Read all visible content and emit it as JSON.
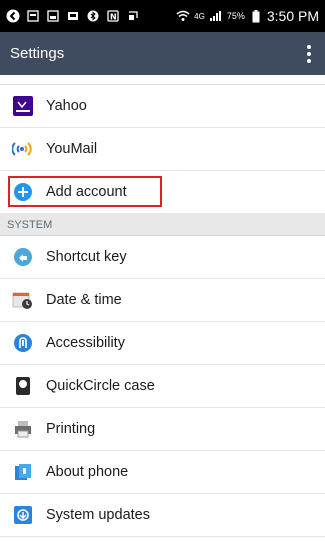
{
  "status_bar": {
    "battery_percent": "75%",
    "time": "3:50 PM",
    "network": "4G"
  },
  "app_bar": {
    "title": "Settings"
  },
  "accounts": [
    {
      "label": "Yahoo",
      "icon": "yahoo-icon"
    },
    {
      "label": "YouMail",
      "icon": "youmail-icon"
    },
    {
      "label": "Add account",
      "icon": "add-icon"
    }
  ],
  "system": {
    "header": "SYSTEM",
    "items": [
      {
        "label": "Shortcut key",
        "icon": "shortcut-key-icon"
      },
      {
        "label": "Date & time",
        "icon": "date-time-icon"
      },
      {
        "label": "Accessibility",
        "icon": "accessibility-icon"
      },
      {
        "label": "QuickCircle case",
        "icon": "quickcircle-icon"
      },
      {
        "label": "Printing",
        "icon": "printer-icon"
      },
      {
        "label": "About phone",
        "icon": "about-phone-icon"
      },
      {
        "label": "System updates",
        "icon": "system-updates-icon"
      }
    ]
  },
  "colors": {
    "app_bar": "#3f4b5e",
    "highlight": "#e11f26",
    "accent_blue": "#2196f3"
  }
}
